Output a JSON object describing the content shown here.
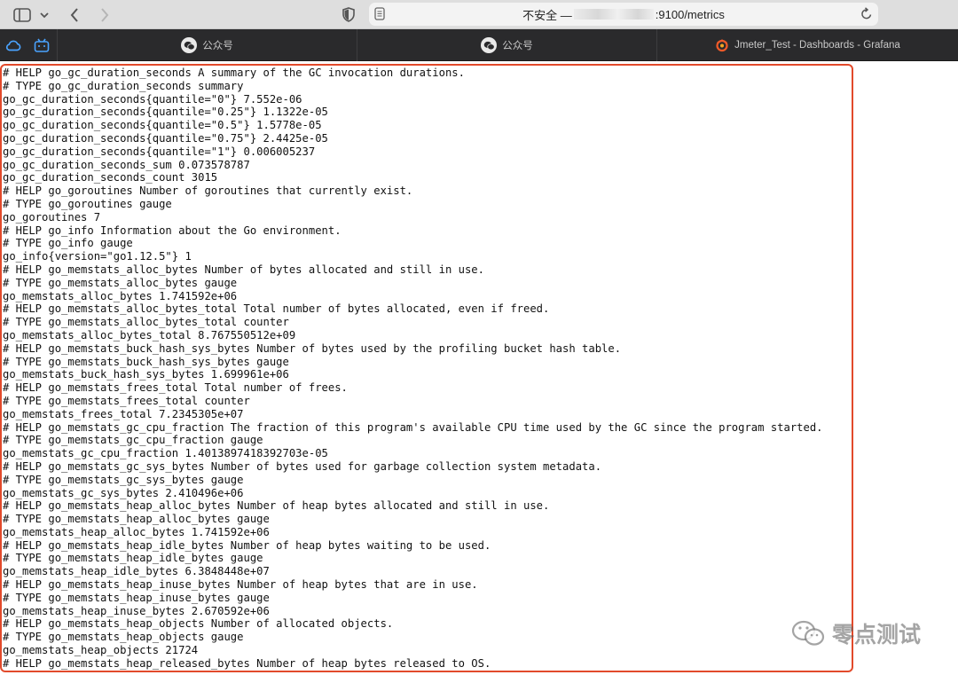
{
  "browser": {
    "address": {
      "prefix": "不安全 —",
      "suffix": ":9100/metrics"
    }
  },
  "tabs": [
    {
      "label": "公众号",
      "icon": "wechat-icon"
    },
    {
      "label": "公众号",
      "icon": "wechat-icon"
    },
    {
      "label": "Jmeter_Test - Dashboards - Grafana",
      "icon": "grafana-icon"
    }
  ],
  "metrics_lines": [
    "# HELP go_gc_duration_seconds A summary of the GC invocation durations.",
    "# TYPE go_gc_duration_seconds summary",
    "go_gc_duration_seconds{quantile=\"0\"} 7.552e-06",
    "go_gc_duration_seconds{quantile=\"0.25\"} 1.1322e-05",
    "go_gc_duration_seconds{quantile=\"0.5\"} 1.5778e-05",
    "go_gc_duration_seconds{quantile=\"0.75\"} 2.4425e-05",
    "go_gc_duration_seconds{quantile=\"1\"} 0.006005237",
    "go_gc_duration_seconds_sum 0.073578787",
    "go_gc_duration_seconds_count 3015",
    "# HELP go_goroutines Number of goroutines that currently exist.",
    "# TYPE go_goroutines gauge",
    "go_goroutines 7",
    "# HELP go_info Information about the Go environment.",
    "# TYPE go_info gauge",
    "go_info{version=\"go1.12.5\"} 1",
    "# HELP go_memstats_alloc_bytes Number of bytes allocated and still in use.",
    "# TYPE go_memstats_alloc_bytes gauge",
    "go_memstats_alloc_bytes 1.741592e+06",
    "# HELP go_memstats_alloc_bytes_total Total number of bytes allocated, even if freed.",
    "# TYPE go_memstats_alloc_bytes_total counter",
    "go_memstats_alloc_bytes_total 8.767550512e+09",
    "# HELP go_memstats_buck_hash_sys_bytes Number of bytes used by the profiling bucket hash table.",
    "# TYPE go_memstats_buck_hash_sys_bytes gauge",
    "go_memstats_buck_hash_sys_bytes 1.699961e+06",
    "# HELP go_memstats_frees_total Total number of frees.",
    "# TYPE go_memstats_frees_total counter",
    "go_memstats_frees_total 7.2345305e+07",
    "# HELP go_memstats_gc_cpu_fraction The fraction of this program's available CPU time used by the GC since the program started.",
    "# TYPE go_memstats_gc_cpu_fraction gauge",
    "go_memstats_gc_cpu_fraction 1.4013897418392703e-05",
    "# HELP go_memstats_gc_sys_bytes Number of bytes used for garbage collection system metadata.",
    "# TYPE go_memstats_gc_sys_bytes gauge",
    "go_memstats_gc_sys_bytes 2.410496e+06",
    "# HELP go_memstats_heap_alloc_bytes Number of heap bytes allocated and still in use.",
    "# TYPE go_memstats_heap_alloc_bytes gauge",
    "go_memstats_heap_alloc_bytes 1.741592e+06",
    "# HELP go_memstats_heap_idle_bytes Number of heap bytes waiting to be used.",
    "# TYPE go_memstats_heap_idle_bytes gauge",
    "go_memstats_heap_idle_bytes 6.3848448e+07",
    "# HELP go_memstats_heap_inuse_bytes Number of heap bytes that are in use.",
    "# TYPE go_memstats_heap_inuse_bytes gauge",
    "go_memstats_heap_inuse_bytes 2.670592e+06",
    "# HELP go_memstats_heap_objects Number of allocated objects.",
    "# TYPE go_memstats_heap_objects gauge",
    "go_memstats_heap_objects 21724",
    "# HELP go_memstats_heap_released_bytes Number of heap bytes released to OS."
  ],
  "watermark": {
    "text": "零点测试"
  },
  "colors": {
    "highlight_border": "#e24a2b",
    "tabbar_bg": "#2a2a2c",
    "toolbar_bg": "#dedede"
  }
}
